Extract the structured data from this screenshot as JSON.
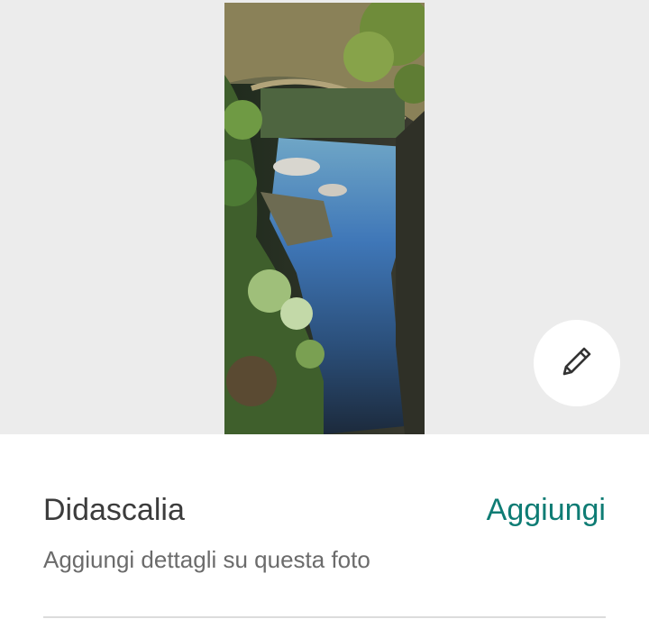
{
  "photo": {
    "description_alt": ""
  },
  "edit_button": {
    "icon": "pencil-icon"
  },
  "caption": {
    "title": "Didascalia",
    "action_label": "Aggiungi",
    "subtitle": "Aggiungi dettagli su questa foto"
  },
  "colors": {
    "accent": "#0e7c74",
    "photo_background": "#ececec",
    "title_text": "#3c3c3c",
    "subtitle_text": "#6b6b6b"
  }
}
